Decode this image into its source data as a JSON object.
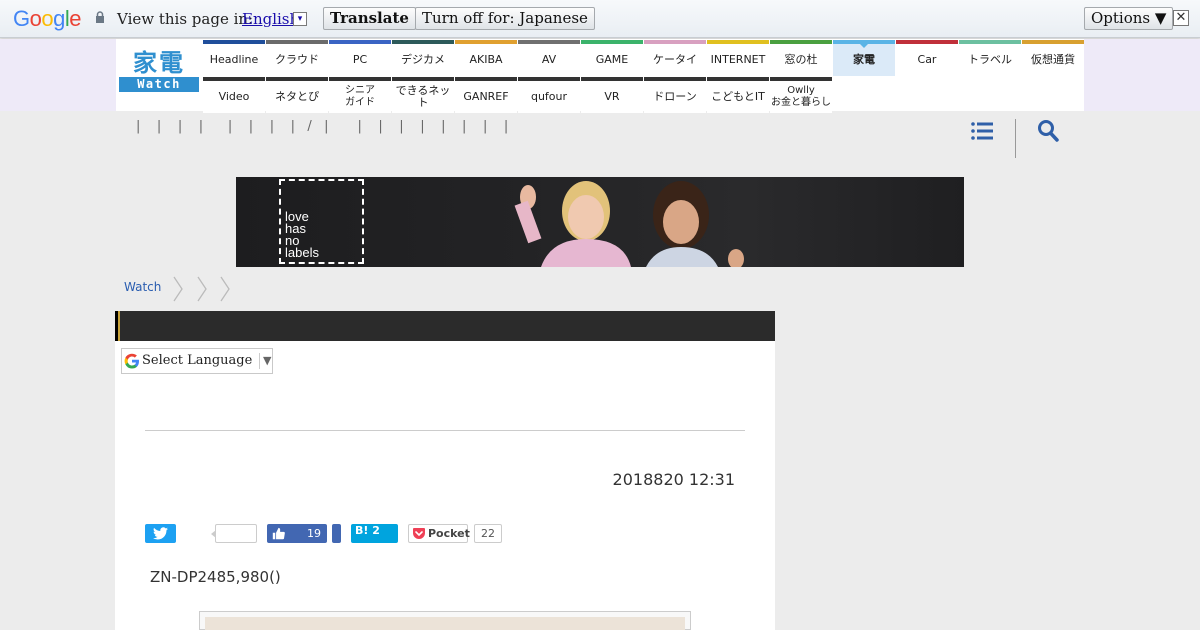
{
  "translate_bar": {
    "logo": [
      {
        "ch": "G",
        "color": "#4285f4"
      },
      {
        "ch": "o",
        "color": "#ea4335"
      },
      {
        "ch": "o",
        "color": "#fbbc05"
      },
      {
        "ch": "g",
        "color": "#4285f4"
      },
      {
        "ch": "l",
        "color": "#34a853"
      },
      {
        "ch": "e",
        "color": "#ea4335"
      }
    ],
    "prompt": "View this page in:",
    "language": "English",
    "translate_label": "Translate",
    "turn_off_label": "Turn off for: Japanese",
    "options_label": "Options ▼",
    "close_label": "✕"
  },
  "logo": {
    "top": "家電",
    "bottom": "Watch",
    "color": "#2f8fcf"
  },
  "nav": {
    "row1": [
      {
        "label": "Headline",
        "color": "#1f4e9b"
      },
      {
        "label": "クラウド",
        "color": "#6b6b6b"
      },
      {
        "label": "PC",
        "color": "#3a64c4"
      },
      {
        "label": "デジカメ",
        "color": "#2d5a5a"
      },
      {
        "label": "AKIBA",
        "color": "#e0a030"
      },
      {
        "label": "AV",
        "color": "#707070"
      },
      {
        "label": "GAME",
        "color": "#3bb36b"
      },
      {
        "label": "ケータイ",
        "color": "#d8a0c0"
      },
      {
        "label": "INTERNET",
        "color": "#e0c020"
      },
      {
        "label": "窓の杜",
        "color": "#4aa040"
      },
      {
        "label": "家電",
        "color": "#5ab4e6",
        "active": true
      },
      {
        "label": "Car",
        "color": "#c0303a"
      },
      {
        "label": "トラベル",
        "color": "#6cc0a0"
      },
      {
        "label": "仮想通貨",
        "color": "#d8a030"
      }
    ],
    "row2": [
      {
        "label": "Video"
      },
      {
        "label": "ネタとぴ"
      },
      {
        "label": "シニア\nガイド"
      },
      {
        "label": "できるネット"
      },
      {
        "label": "GANREF"
      },
      {
        "label": "qufour"
      },
      {
        "label": "VR"
      },
      {
        "label": "ドローン"
      },
      {
        "label": "こどもとIT"
      },
      {
        "label": "Owlly\nお金と暮らし"
      }
    ]
  },
  "subnav": {
    "pipes": "|    |    |    |      |    |    |    |   /   |       |    |    |    |    |    |    |    |"
  },
  "banner": {
    "lines": [
      "love",
      "has",
      "no",
      "labels"
    ]
  },
  "breadcrumb": {
    "home": "Watch"
  },
  "article": {
    "language_select": "Select Language",
    "date": "2018820 12:31",
    "fb_count": "19",
    "hatena_label": "B! 2",
    "pocket_label": "Pocket",
    "pocket_count": "22",
    "lead": "ZN-DP2485,980()"
  }
}
